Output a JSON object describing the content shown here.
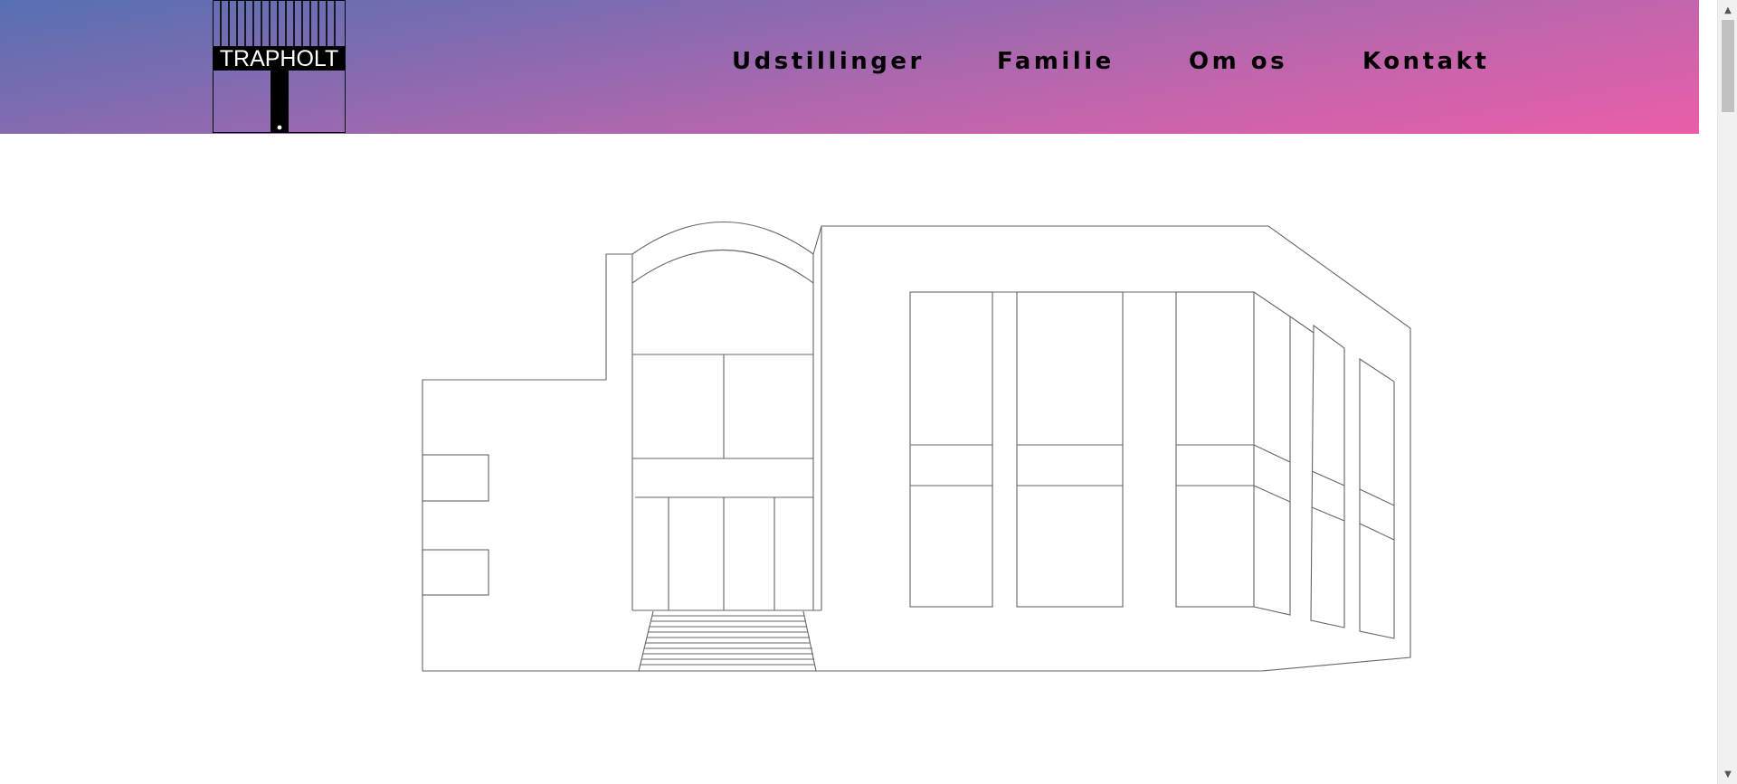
{
  "brand": {
    "logo_text": "TRAPHOLT"
  },
  "nav": {
    "items": [
      {
        "label": "Udstillinger"
      },
      {
        "label": "Familie"
      },
      {
        "label": "Om os"
      },
      {
        "label": "Kontakt"
      }
    ]
  },
  "colors": {
    "header_gradient": [
      "#5670b2",
      "#8c6ab0",
      "#bd66ad",
      "#ea5ea8"
    ],
    "nav_text": "#000000",
    "drawing_stroke": "#555555"
  },
  "icons": {
    "scroll_up": "chevron-up-icon",
    "scroll_down": "chevron-down-icon"
  }
}
